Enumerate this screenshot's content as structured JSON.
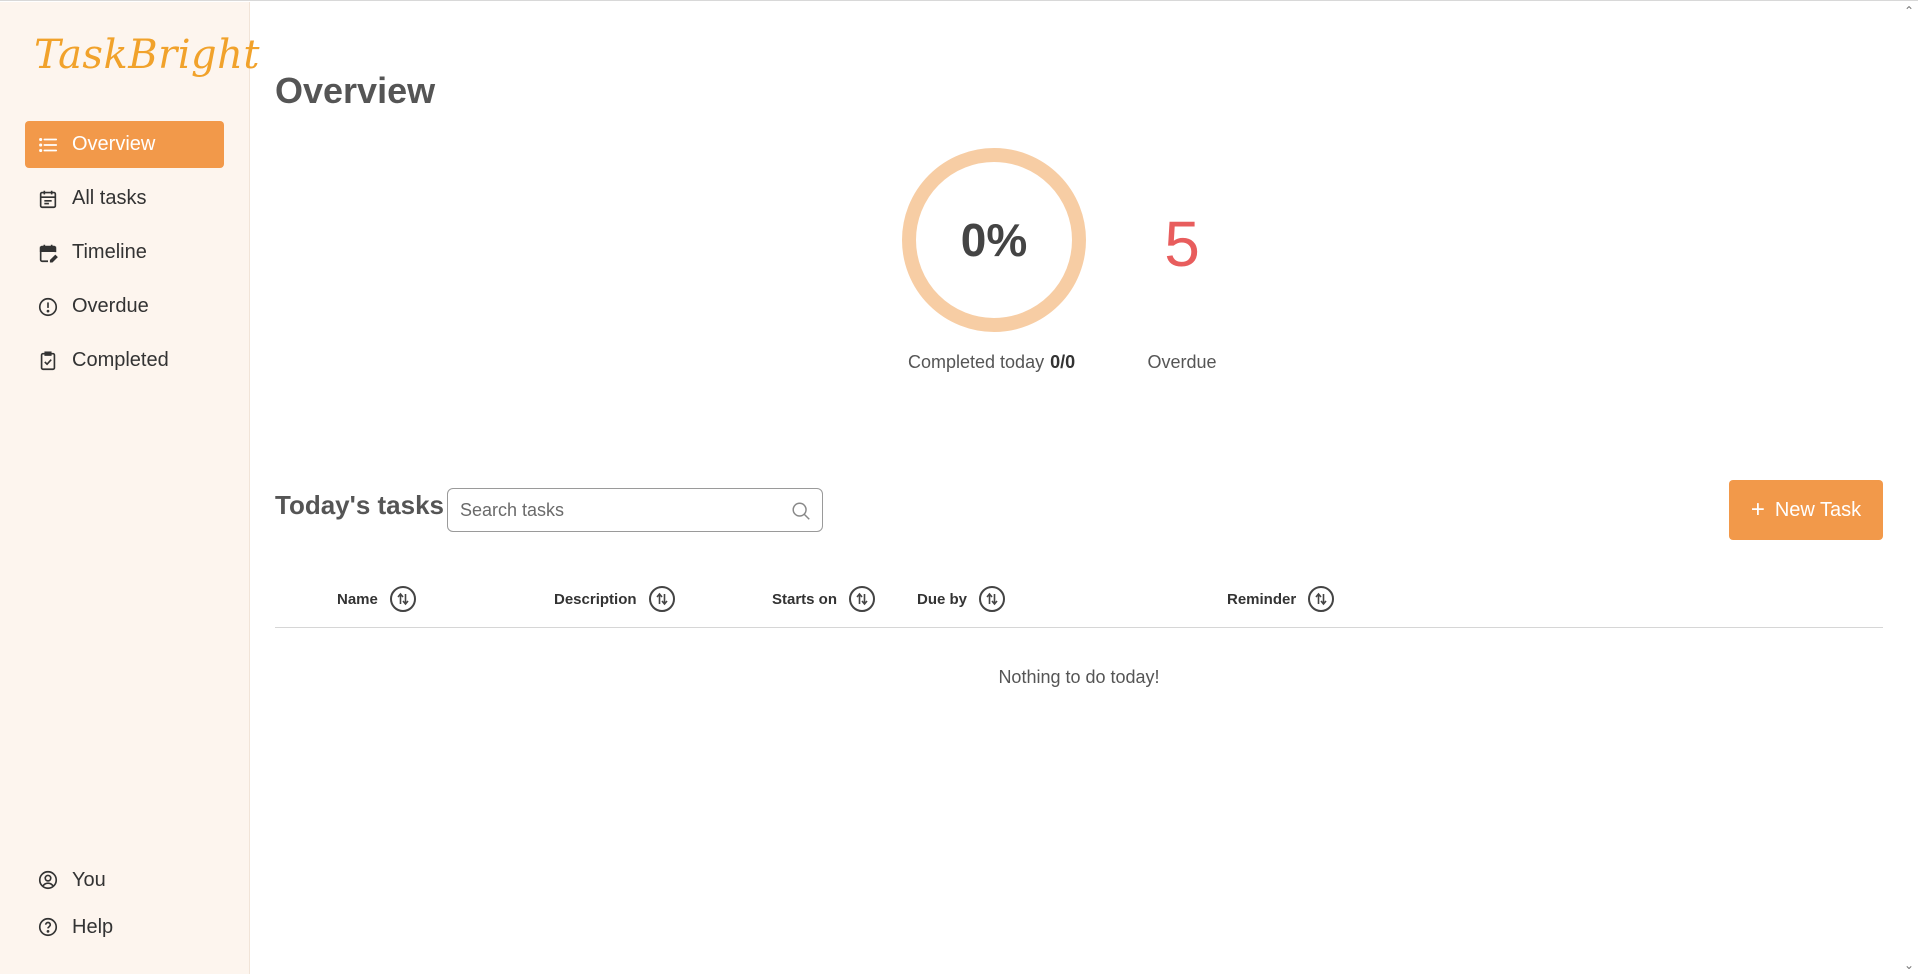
{
  "app": {
    "logo": "TaskBright"
  },
  "sidebar": {
    "items": [
      {
        "label": "Overview",
        "icon": "list-icon",
        "active": true
      },
      {
        "label": "All tasks",
        "icon": "calendar-icon"
      },
      {
        "label": "Timeline",
        "icon": "calendar-edit-icon"
      },
      {
        "label": "Overdue",
        "icon": "alert-circle-icon"
      },
      {
        "label": "Completed",
        "icon": "clipboard-check-icon"
      }
    ],
    "bottom": [
      {
        "label": "You",
        "icon": "user-circle-icon"
      },
      {
        "label": "Help",
        "icon": "help-circle-icon"
      }
    ]
  },
  "main": {
    "title": "Overview",
    "stats": {
      "completed_percent": "0%",
      "completed_fraction": 0,
      "completed_label": "Completed today",
      "completed_count": "0/0",
      "overdue_count": "5",
      "overdue_label": "Overdue"
    },
    "tasks": {
      "title": "Today's tasks",
      "search_placeholder": "Search tasks",
      "search_value": "",
      "new_task_label": "New Task",
      "columns": [
        "Name",
        "Description",
        "Starts on",
        "Due by",
        "Reminder"
      ],
      "empty_message": "Nothing to do today!"
    }
  },
  "colors": {
    "accent": "#f2994a",
    "ring": "#f7cda4",
    "overdue": "#e85d5d",
    "logo": "#f1a22b"
  }
}
